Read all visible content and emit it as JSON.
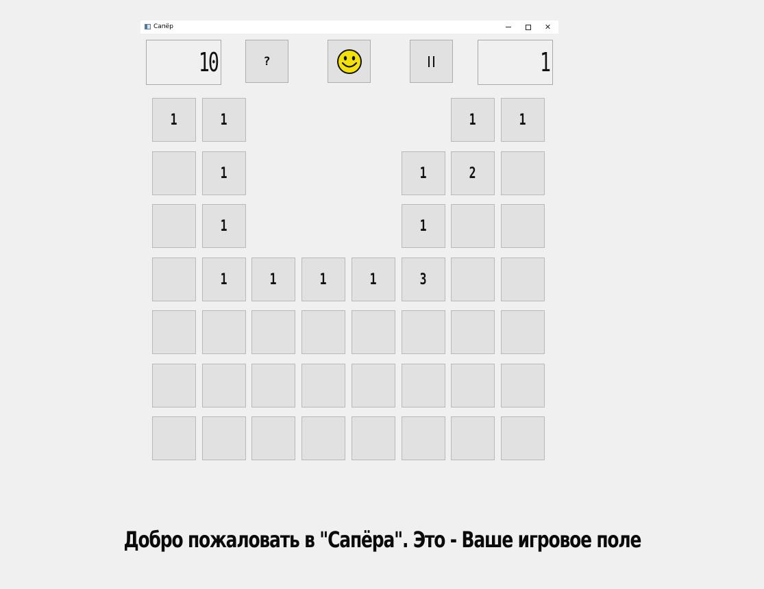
{
  "window": {
    "title": "Сапёр",
    "controls": {
      "minimize": "minimize-icon",
      "maximize": "maximize-icon",
      "close": "close-icon",
      "close_glyph": "✕"
    }
  },
  "toolbar": {
    "mines_counter": "10",
    "hint_label": "?",
    "face_icon": "smiley-face-icon",
    "pause_icon": "pause-icon",
    "timer": "1"
  },
  "board": {
    "rows": 7,
    "cols": 8,
    "cells": [
      [
        "1",
        "1",
        "",
        "",
        "",
        "",
        "1",
        "1"
      ],
      [
        "#",
        "1",
        "",
        "",
        "",
        "1",
        "2",
        "#"
      ],
      [
        "#",
        "1",
        "",
        "",
        "",
        "1",
        "#",
        "#"
      ],
      [
        "#",
        "1",
        "1",
        "1",
        "1",
        "3",
        "#",
        "#"
      ],
      [
        "#",
        "#",
        "#",
        "#",
        "#",
        "#",
        "#",
        "#"
      ],
      [
        "#",
        "#",
        "#",
        "#",
        "#",
        "#",
        "#",
        "#"
      ],
      [
        "#",
        "#",
        "#",
        "#",
        "#",
        "#",
        "#",
        "#"
      ]
    ]
  },
  "message": "Добро пожаловать в \"Сапёра\". Это - Ваше игровое поле",
  "colors": {
    "background": "#f0f0f0",
    "cell": "#e1e1e1",
    "cell_border": "#b8b8b8",
    "smiley": "#f5e10a"
  }
}
